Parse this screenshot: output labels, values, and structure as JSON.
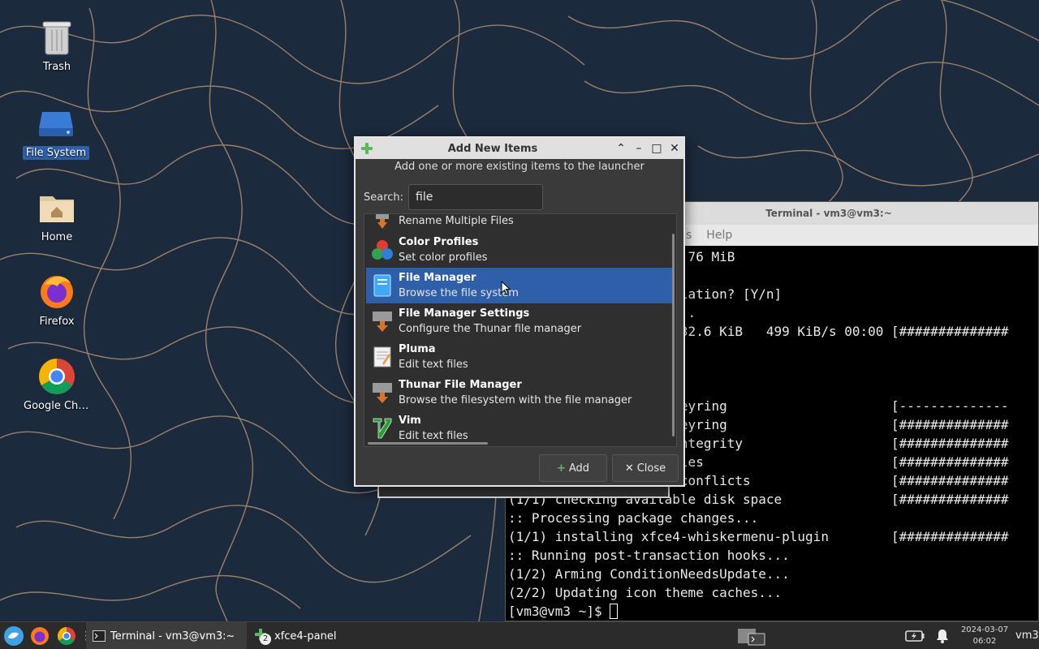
{
  "desktop": {
    "icons": [
      {
        "label": "Trash",
        "icon": "trash-icon"
      },
      {
        "label": "File System",
        "icon": "drive-icon"
      },
      {
        "label": "Home",
        "icon": "home-folder-icon"
      },
      {
        "label": "Firefox",
        "icon": "firefox-icon"
      },
      {
        "label": "Google Chro...",
        "icon": "chrome-icon"
      }
    ]
  },
  "terminal": {
    "title": "Terminal - vm3@vm3:~",
    "menu": [
      "s",
      "Help"
    ],
    "lines": [
      "                     0.76 MiB",
      "",
      "                     llation? [Y/n]",
      "                     ...",
      "                     232.6 KiB   499 KiB/s 00:00 [##############",
      "",
      "",
      "",
      "                     keyring                     [--------------",
      "                     keyring                     [##############",
      "                     integrity                   [##############",
      "                    files                        [##############",
      "                    e conflicts                  [##############",
      "(1/1) checking available disk space              [##############",
      ":: Processing package changes...",
      "(1/1) installing xfce4-whiskermenu-plugin        [##############",
      ":: Running post-transaction hooks...",
      "(1/2) Arming ConditionNeedsUpdate...",
      "(2/2) Updating icon theme caches..."
    ],
    "prompt": "[vm3@vm3 ~]$ "
  },
  "dialog": {
    "title": "Add New Items",
    "subtitle": "Add one or more existing items to the launcher",
    "search_label": "Search:",
    "search_value": "file",
    "items": [
      {
        "name": "",
        "desc": "Rename Multiple Files",
        "icon": "rename-icon"
      },
      {
        "name": "Color Profiles",
        "desc": "Set color profiles",
        "icon": "color-profiles-icon"
      },
      {
        "name": "File Manager",
        "desc": "Browse the file system",
        "icon": "file-manager-icon"
      },
      {
        "name": "File Manager Settings",
        "desc": "Configure the Thunar file manager",
        "icon": "file-manager-settings-icon"
      },
      {
        "name": "Pluma",
        "desc": "Edit text files",
        "icon": "pluma-icon"
      },
      {
        "name": "Thunar File Manager",
        "desc": "Browse the filesystem with the file manager",
        "icon": "thunar-icon"
      },
      {
        "name": "Vim",
        "desc": "Edit text files",
        "icon": "vim-icon"
      }
    ],
    "selected_index": 2,
    "add_label": "Add",
    "close_label": "Close"
  },
  "taskbar": {
    "tasks": [
      {
        "label": "Terminal - vm3@vm3:~",
        "active": true
      },
      {
        "label": "xfce4-panel",
        "badge": "2"
      }
    ],
    "clock_date": "2024-03-07",
    "clock_time": "06:02",
    "user": "vm3"
  },
  "colors": {
    "selection": "#2e5fa8",
    "wallpaper": "#1c2a3d"
  }
}
